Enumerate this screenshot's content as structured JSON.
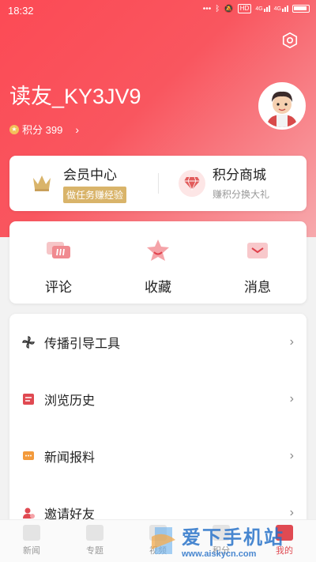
{
  "status_bar": {
    "time": "18:32",
    "dots": "•••",
    "hd": "HD",
    "signal": "4G",
    "network": "4G"
  },
  "profile": {
    "username": "读友_KY3JV9",
    "points_label": "积分 399",
    "chevron": "›"
  },
  "vip_card": {
    "title": "会员中心",
    "tag": "做任务赚经验"
  },
  "shop_card": {
    "title": "积分商城",
    "subtitle": "赚积分换大礼"
  },
  "quick_actions": [
    {
      "label": "评论",
      "icon": "comment-icon"
    },
    {
      "label": "收藏",
      "icon": "star-icon"
    },
    {
      "label": "消息",
      "icon": "message-icon"
    }
  ],
  "menu": [
    {
      "label": "传播引导工具",
      "icon": "pinwheel-icon"
    },
    {
      "label": "浏览历史",
      "icon": "history-icon"
    },
    {
      "label": "新闻报料",
      "icon": "report-icon"
    },
    {
      "label": "邀请好友",
      "icon": "invite-icon"
    }
  ],
  "tabs": [
    {
      "label": "新闻"
    },
    {
      "label": "专题"
    },
    {
      "label": "视频"
    },
    {
      "label": "积分"
    },
    {
      "label": "我的"
    }
  ],
  "watermark": {
    "title": "爱下手机站",
    "url": "www.aiskycn.com"
  },
  "colors": {
    "accent": "#fc4a55",
    "gold": "#d9b46a",
    "watermark": "#2a73c9"
  }
}
